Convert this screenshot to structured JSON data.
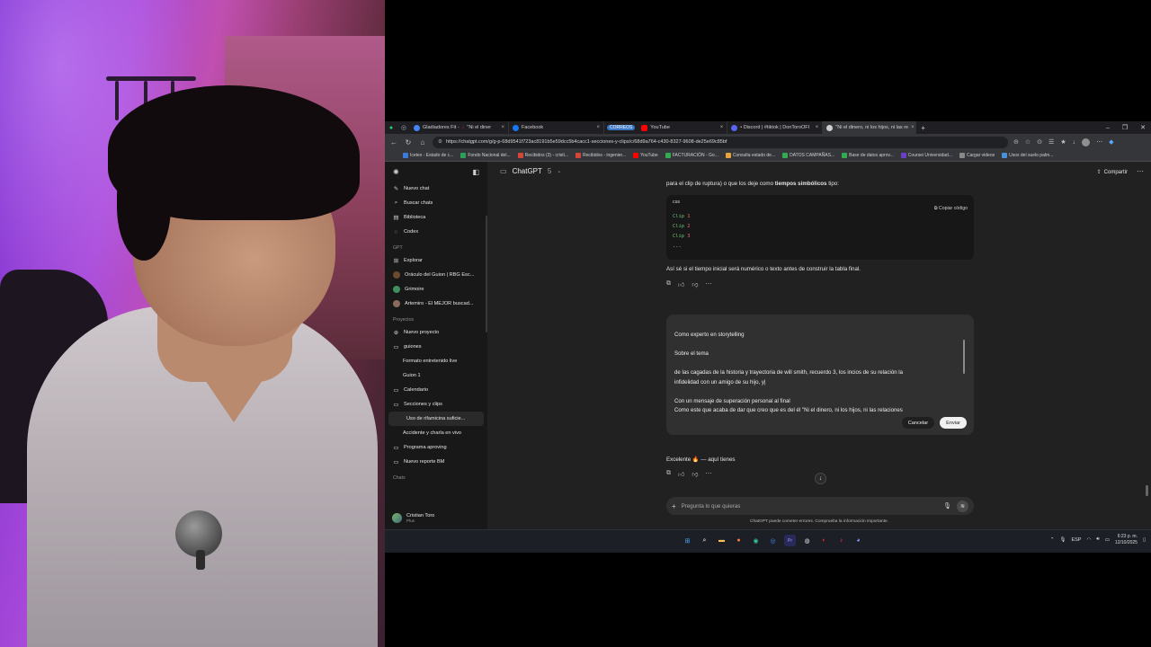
{
  "browser": {
    "tabs": [
      {
        "label": "Gladiadores Fit - ",
        "extra": "\"Ni el diner",
        "color": "#4285f4"
      },
      {
        "label": "Facebook",
        "color": "#1877f2"
      },
      {
        "group": "CORREOS",
        "label": "YouTube",
        "color": "#ff0000"
      },
      {
        "label": "• Discord | #tiktok | DonToroOFI",
        "color": "#5865f2"
      },
      {
        "label": "\"Ni el dinero, ni los hijos, ni las re",
        "color": "#cfcfcf",
        "active": true
      }
    ],
    "url": "https://chatgpt.com/g/g-p-68d9541f723ac8191b5e59dcc5b4cacc1-secciones-y-clips/c/68d9a764-c430-8327-9608-de25e69c85bf",
    "bookmarks": [
      {
        "label": "Icetex - Estado de c...",
        "color": "#3e7bd6"
      },
      {
        "label": "Fondo Nacional del...",
        "color": "#2e9f5b"
      },
      {
        "label": "Recibidos (3) - cristi...",
        "color": "#d44638"
      },
      {
        "label": "Recibidos - ingenier...",
        "color": "#d44638"
      },
      {
        "label": "YouTube",
        "color": "#ff0000"
      },
      {
        "label": "FACTURACIÓN - Go...",
        "color": "#34a853"
      },
      {
        "label": "Consulta estado de...",
        "color": "#e8a33d"
      },
      {
        "label": "DATOS CAMPAÑAS...",
        "color": "#34a853"
      },
      {
        "label": "Base de datos aprov...",
        "color": "#34a853"
      },
      {
        "label": "Coursei Universidad...",
        "color": "#6a3fc8"
      },
      {
        "label": "Cargar videos",
        "color": "#888888"
      },
      {
        "label": "Usos del suelo palm...",
        "color": "#4b8fd6"
      }
    ]
  },
  "sidebar": {
    "top_items": [
      {
        "icon": "✎",
        "label": "Nuevo chat"
      },
      {
        "icon": "⌕",
        "label": "Buscar chats"
      },
      {
        "icon": "▤",
        "label": "Biblioteca"
      },
      {
        "icon": "◌",
        "label": "Codex"
      }
    ],
    "gpt_section": "GPT",
    "gpt_items": [
      {
        "icon": "⊞",
        "label": "Explorar"
      },
      {
        "label": "Oráculo del Guion | RBG Esc...",
        "color": "#6a4a2c"
      },
      {
        "label": "Grimoire",
        "color": "#3f8f5f"
      },
      {
        "label": "Artemiro - El MEJOR buscad...",
        "color": "#8a6a5a"
      }
    ],
    "projects_section": "Proyectos",
    "project_items": [
      {
        "icon": "⊕",
        "label": "Nuevo proyecto",
        "indent": false
      },
      {
        "icon": "▭",
        "label": "guiones",
        "indent": false
      },
      {
        "label": "Formato entretenido live",
        "indent": true
      },
      {
        "label": "Guion 1",
        "indent": true
      },
      {
        "icon": "▭",
        "label": "Calendario",
        "indent": false
      },
      {
        "icon": "▭",
        "label": "Secciones y clips",
        "indent": false
      },
      {
        "label": "Uso de rifamicina suficie...",
        "indent": true,
        "selected": true
      },
      {
        "label": "Accidente y charla en vivo",
        "indent": true
      },
      {
        "icon": "▭",
        "label": "Programa aproving",
        "indent": false
      },
      {
        "icon": "▭",
        "label": "Nuevo reporte BM",
        "indent": false
      }
    ],
    "chats_section": "Chats",
    "user": {
      "name": "Cristian Toro",
      "plan": "Plus"
    }
  },
  "topbar": {
    "model": "ChatGPT",
    "version": "5",
    "share": "Compartir"
  },
  "conversation": {
    "cut_line_pre": "para el clip de ruptura) o que los deje como ",
    "cut_line_bold": "tiempos simbólicos",
    "cut_line_post": " tipo:",
    "code": {
      "lang": "css",
      "copy": "Copiar código",
      "lines": [
        {
          "k": "Clip",
          "n": "1"
        },
        {
          "k": "Clip",
          "n": "2"
        },
        {
          "k": "Clip",
          "n": "3"
        }
      ],
      "ellipsis": "..."
    },
    "followup": "Así sé si el tiempo inicial será numérico o texto antes de construir la tabla final.",
    "edit": {
      "line1": "Como experto en storytelling",
      "line2": "Sobre el tema",
      "line3": "de las cagadas de la historia y trayectoria de will smith, recuerdo 3, los incios de su relación la",
      "line4": "infidelidad con un amigo de su hijo, y|",
      "line5": "Con un mensaje de superación personal al final",
      "line6": "Como este que acaba de dar que creo que es del él \"Ni el dinero, ni los hijos, ni las relaciones",
      "cancel": "Cancelar",
      "send": "Enviar"
    },
    "reply": "Excelente 🔥 — aquí tienes"
  },
  "composer": {
    "placeholder": "Pregunta lo que quieras"
  },
  "disclaimer": "ChatGPT puede cometer errores. Comprueba la información importante.",
  "taskbar": {
    "lang": "ESP",
    "time": "6:23 p. m.",
    "date": "12/10/2025"
  }
}
